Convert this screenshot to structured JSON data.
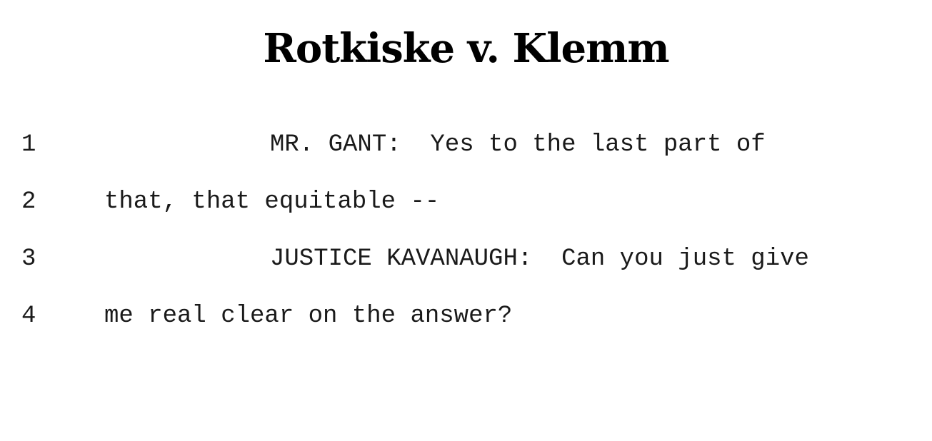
{
  "document": {
    "title": "Rotkiske v. Klemm",
    "lines": [
      {
        "number": "1",
        "text": "MR. GANT:  Yes to the last part of"
      },
      {
        "number": "2",
        "text": "that, that equitable --"
      },
      {
        "number": "3",
        "text": "JUSTICE KAVANAUGH:  Can you just give"
      },
      {
        "number": "4",
        "text": "me real clear on the answer?"
      }
    ]
  }
}
